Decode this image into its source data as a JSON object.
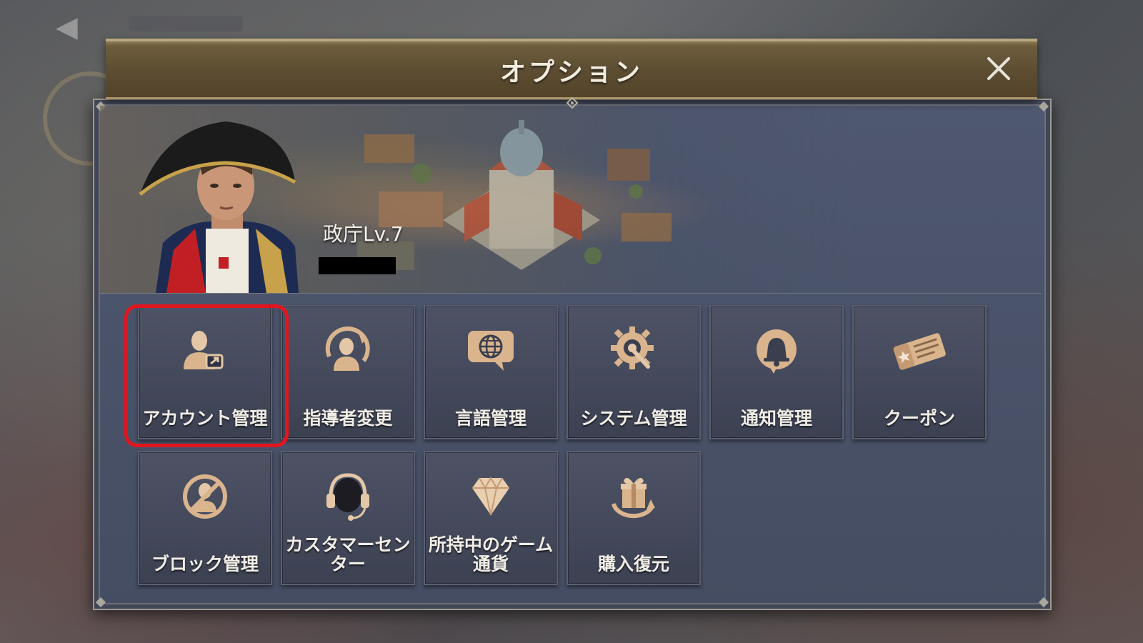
{
  "dialog": {
    "title": "オプション",
    "close_icon": "close-icon"
  },
  "profile": {
    "hq_level": "政庁Lv.7",
    "player_name": "[redacted]"
  },
  "menu": {
    "items": [
      {
        "label": "アカウント管理",
        "icon": "account-switch-icon",
        "highlighted": true
      },
      {
        "label": "指導者変更",
        "icon": "change-leader-icon"
      },
      {
        "label": "言語管理",
        "icon": "language-globe-icon"
      },
      {
        "label": "システム管理",
        "icon": "system-gear-icon"
      },
      {
        "label": "通知管理",
        "icon": "notification-bell-icon"
      },
      {
        "label": "クーポン",
        "icon": "coupon-ticket-icon"
      },
      {
        "label": "ブロック管理",
        "icon": "block-user-icon"
      },
      {
        "label": "カスタマーセンター",
        "icon": "customer-headset-icon"
      },
      {
        "label": "所持中のゲーム通貨",
        "icon": "diamond-icon"
      },
      {
        "label": "購入復元",
        "icon": "restore-gift-icon"
      }
    ]
  },
  "colors": {
    "accent_gold": "#b9a880",
    "highlight_red": "#e4141f",
    "panel_bg": "#4a5369"
  }
}
